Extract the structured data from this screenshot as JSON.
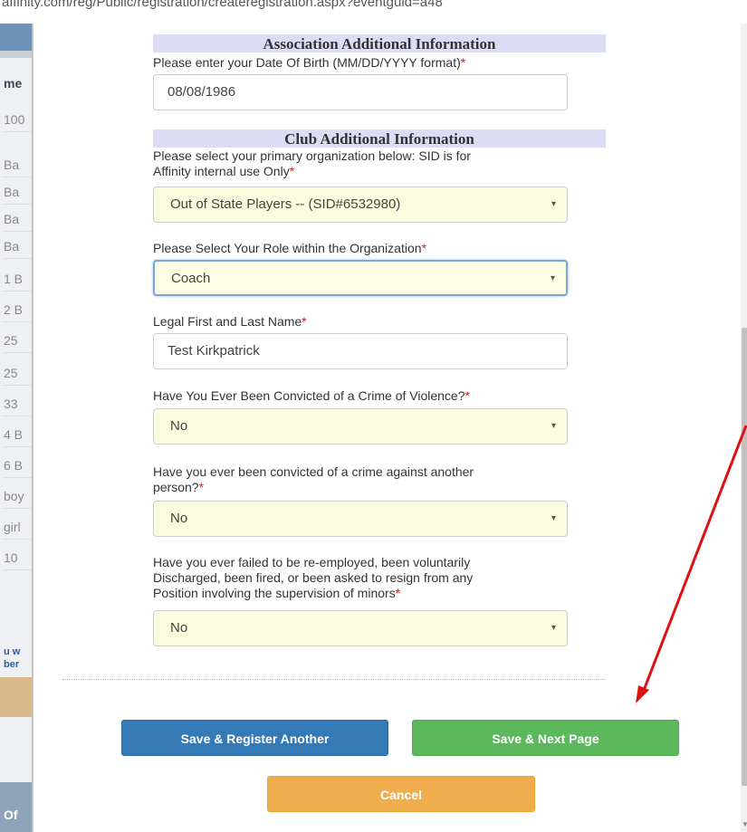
{
  "url": "affinity.com/reg/Public/registration/createregistration.aspx?eventguid=a48",
  "background_page": {
    "header_fragment": "me",
    "cells": [
      "100",
      "Ba",
      "Ba",
      "Ba",
      "Ba",
      "1 B",
      "2 B",
      "25",
      "25",
      "33",
      "4 B",
      "6 B",
      "boy",
      "girl",
      "10"
    ],
    "link_lines": [
      "u w",
      "ber"
    ],
    "footer_fragment": "Of"
  },
  "form": {
    "association_header": "Association Additional Information",
    "dob": {
      "label": "Please enter your Date Of Birth (MM/DD/YYYY format)",
      "value": "08/08/1986"
    },
    "club_header": "Club Additional Information",
    "organization": {
      "label_line1": "Please select your primary organization below: SID is for",
      "label_line2": "Affinity internal use Only",
      "selected": "Out of State Players -- (SID#6532980)"
    },
    "role": {
      "label": "Please Select Your Role within the Organization",
      "selected": "Coach"
    },
    "legal_name": {
      "label": "Legal First and Last Name",
      "value": "Test Kirkpatrick"
    },
    "crime_violence": {
      "label": "Have You Ever Been Convicted of a Crime of Violence?",
      "selected": "No"
    },
    "crime_person": {
      "label_line1": "Have you ever been convicted of a crime against another",
      "label_line2": "person?",
      "selected": "No"
    },
    "employment": {
      "label_line1": "Have you ever failed to be re-employed, been voluntarily",
      "label_line2": "Discharged, been fired, or been asked to resign from any",
      "label_line3": "Position involving the supervision of minors",
      "selected": "No"
    },
    "required_mark": "*"
  },
  "buttons": {
    "save_register_another": "Save & Register Another",
    "save_next_page": "Save & Next Page",
    "cancel": "Cancel"
  },
  "colors": {
    "header_bg": "#dcdcf5",
    "select_bg": "#fbfbdd",
    "blue_button": "#337ab7",
    "green_button": "#5cb85c",
    "orange_button": "#f0ad4e",
    "required": "#cc2222",
    "annotation_arrow": "#e01010"
  },
  "icons": {
    "select_caret": "▾"
  }
}
